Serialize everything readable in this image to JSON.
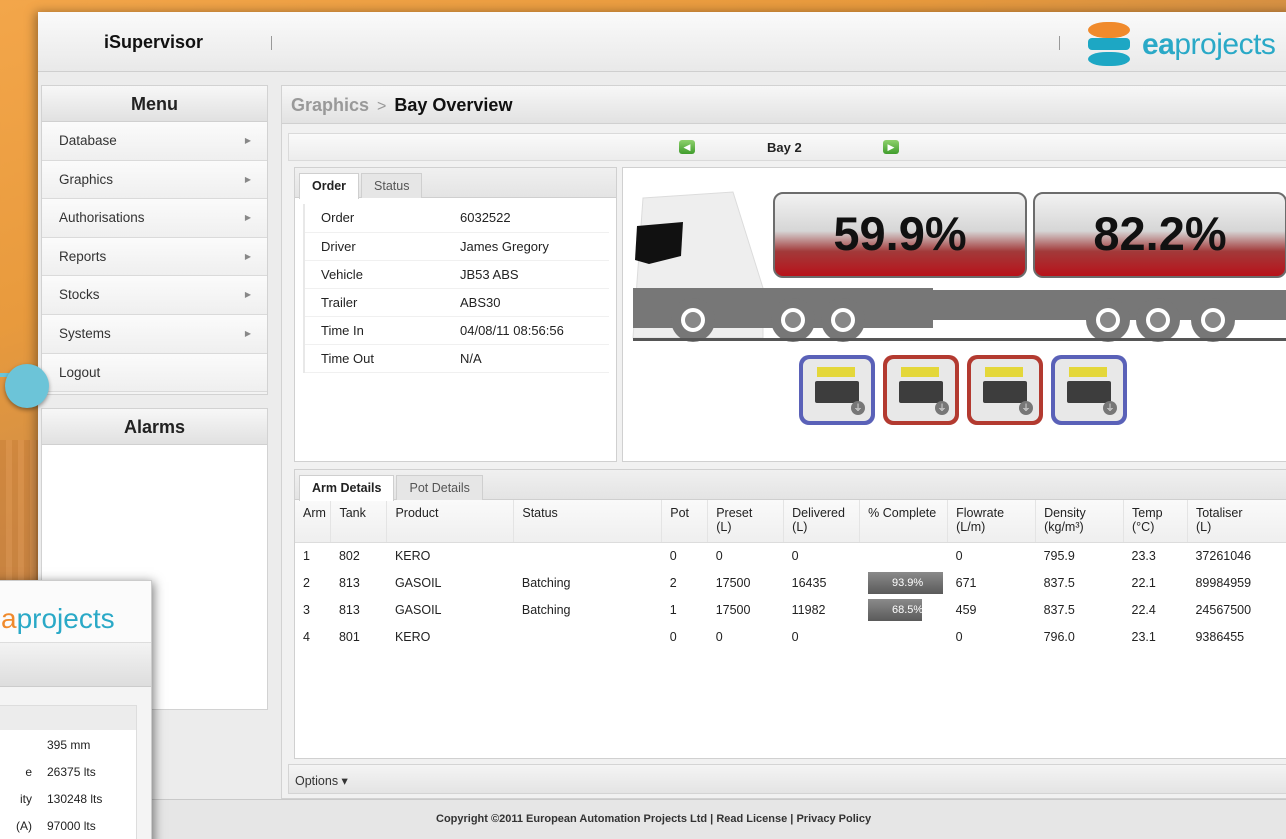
{
  "app": {
    "title": "iSupervisor",
    "logo_text_a": "ea",
    "logo_text_b": "projects"
  },
  "menu": {
    "title": "Menu",
    "items": [
      {
        "label": "Database",
        "arrow": "▶"
      },
      {
        "label": "Graphics",
        "arrow": "▶"
      },
      {
        "label": "Authorisations",
        "arrow": "▶"
      },
      {
        "label": "Reports",
        "arrow": "▶"
      },
      {
        "label": "Stocks",
        "arrow": "▶"
      },
      {
        "label": "Systems",
        "arrow": "▶"
      },
      {
        "label": "Logout",
        "arrow": ""
      }
    ]
  },
  "alarms": {
    "title": "Alarms"
  },
  "breadcrumb": {
    "parent": "Graphics",
    "separator": ">",
    "current": "Bay Overview"
  },
  "bay": {
    "label": "Bay 2",
    "prev_icon": "arrow-left-icon",
    "next_icon": "arrow-right-icon"
  },
  "order_tabs": [
    {
      "label": "Order"
    },
    {
      "label": "Status"
    }
  ],
  "order": [
    {
      "key": "Order",
      "value": "6032522"
    },
    {
      "key": "Driver",
      "value": "James Gregory"
    },
    {
      "key": "Vehicle",
      "value": "JB53 ABS"
    },
    {
      "key": "Trailer",
      "value": "ABS30"
    },
    {
      "key": "Time In",
      "value": "04/08/11 08:56:56"
    },
    {
      "key": "Time Out",
      "value": "N/A"
    }
  ],
  "tanker": {
    "compartments": [
      "59.9%",
      "82.2%"
    ],
    "pots": [
      {
        "color": "blue",
        "icon": "earth-icon"
      },
      {
        "color": "red",
        "icon": "earth-icon"
      },
      {
        "color": "red",
        "icon": "earth-icon"
      },
      {
        "color": "blue",
        "icon": "earth-icon"
      }
    ],
    "colors": {
      "pot_blue": "#5a61b8",
      "pot_red": "#b33a30",
      "tank_red": "#b8121a"
    }
  },
  "arm_tabs": [
    {
      "label": "Arm Details"
    },
    {
      "label": "Pot Details"
    }
  ],
  "arm_table": {
    "headers": [
      {
        "l1": "Arm",
        "l2": ""
      },
      {
        "l1": "Tank",
        "l2": ""
      },
      {
        "l1": "Product",
        "l2": ""
      },
      {
        "l1": "Status",
        "l2": ""
      },
      {
        "l1": "Pot",
        "l2": ""
      },
      {
        "l1": "Preset",
        "l2": "(L)"
      },
      {
        "l1": "Delivered",
        "l2": "(L)"
      },
      {
        "l1": "% Complete",
        "l2": ""
      },
      {
        "l1": "Flowrate",
        "l2": "(L/m)"
      },
      {
        "l1": "Density",
        "l2": "(kg/m³)"
      },
      {
        "l1": "Temp",
        "l2": "(°C)"
      },
      {
        "l1": "Totaliser",
        "l2": "(L)"
      }
    ],
    "rows": [
      {
        "arm": "1",
        "tank": "802",
        "product": "KERO",
        "status": "",
        "pot": "0",
        "preset": "0",
        "delivered": "0",
        "complete": "",
        "complete_frac": 0,
        "flowrate": "0",
        "density": "795.9",
        "temp": "23.3",
        "totaliser": "37261046"
      },
      {
        "arm": "2",
        "tank": "813",
        "product": "GASOIL",
        "status": "Batching",
        "pot": "2",
        "preset": "17500",
        "delivered": "16435",
        "complete": "93.9%",
        "complete_frac": 0.939,
        "flowrate": "671",
        "density": "837.5",
        "temp": "22.1",
        "totaliser": "89984959"
      },
      {
        "arm": "3",
        "tank": "813",
        "product": "GASOIL",
        "status": "Batching",
        "pot": "1",
        "preset": "17500",
        "delivered": "11982",
        "complete": "68.5%",
        "complete_frac": 0.685,
        "flowrate": "459",
        "density": "837.5",
        "temp": "22.4",
        "totaliser": "24567500"
      },
      {
        "arm": "4",
        "tank": "801",
        "product": "KERO",
        "status": "",
        "pot": "0",
        "preset": "0",
        "delivered": "0",
        "complete": "",
        "complete_frac": 0,
        "flowrate": "0",
        "density": "796.0",
        "temp": "23.1",
        "totaliser": "9386455"
      }
    ]
  },
  "options": {
    "label": "Options ▾"
  },
  "footer": {
    "copyright": "Copyright ©2011 European Automation Projects Ltd",
    "sep": " | ",
    "license": "Read License",
    "privacy": "Privacy Policy"
  },
  "inset": {
    "logo_a": "a",
    "logo_b": "projects",
    "rows": [
      {
        "key": "",
        "value": "395 mm"
      },
      {
        "key": "e",
        "value": "26375 lts"
      },
      {
        "key": "ity",
        "value": "130248 lts"
      },
      {
        "key": "(A)",
        "value": "97000 lts"
      }
    ]
  }
}
